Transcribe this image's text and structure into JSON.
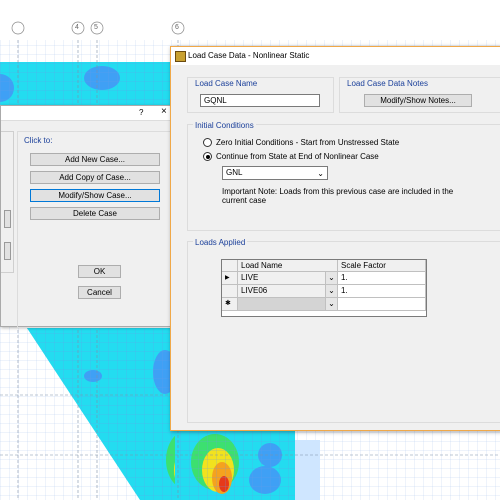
{
  "background": {
    "column_labels": [
      "4",
      "5",
      "6"
    ],
    "contour_colors": [
      "#23dcf0",
      "#3fa0f5",
      "#2f7fe8",
      "#3ce070",
      "#f2e21e",
      "#f5a21e",
      "#e63a1a"
    ]
  },
  "define_dialog": {
    "help_char": "?",
    "close_char": "×",
    "click_to_label": "Click to:",
    "buttons": {
      "add_new": "Add New Case...",
      "add_copy": "Add Copy of Case...",
      "modify_show": "Modify/Show Case...",
      "delete": "Delete Case",
      "ok": "OK",
      "cancel": "Cancel"
    }
  },
  "load_case_dialog": {
    "title": "Load Case Data - Nonlinear Static",
    "name_section": {
      "title": "Load Case Name",
      "value": "GQNL"
    },
    "notes_section": {
      "title": "Load Case Data Notes",
      "button": "Modify/Show Notes..."
    },
    "initial_conditions": {
      "title": "Initial Conditions",
      "option_zero": "Zero Initial Conditions - Start from Unstressed State",
      "option_continue": "Continue from State at End of Nonlinear Case",
      "selected": "continue",
      "prev_case": "GNL",
      "important_note": "Important Note:  Loads from this previous case are included in the current case"
    },
    "loads_applied": {
      "title": "Loads Applied",
      "columns": [
        "Load Name",
        "Scale Factor"
      ],
      "rows": [
        {
          "marker": "▶",
          "load_name": "LIVE",
          "scale": "1."
        },
        {
          "marker": "",
          "load_name": "LIVE06",
          "scale": "1."
        },
        {
          "marker": "✱",
          "load_name": "",
          "scale": ""
        }
      ]
    }
  }
}
